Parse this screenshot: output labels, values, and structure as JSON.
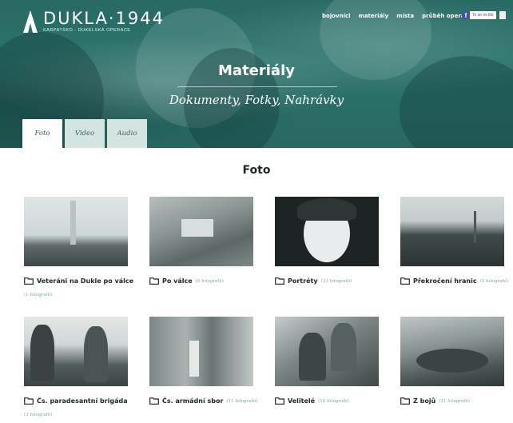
{
  "logo": {
    "title": "DUKLA·1944",
    "subtitle": "KARPATSKO - DUKELSKÁ OPERACE"
  },
  "nav": [
    "bojovníci",
    "materiály",
    "místa",
    "průběh operace"
  ],
  "facebook": {
    "label": "To se mi líbí"
  },
  "hero": {
    "title": "Materiály",
    "subtitle": "Dokumenty, Fotky, Nahrávky"
  },
  "tabs": [
    {
      "label": "Foto",
      "active": true
    },
    {
      "label": "Video",
      "active": false
    },
    {
      "label": "Audio",
      "active": false
    }
  ],
  "section_title": "Foto",
  "galleries": [
    {
      "title": "Veteráni na Dukle po válce",
      "count": "(1 fotografií)"
    },
    {
      "title": "Po válce",
      "count": "(6 fotografií)"
    },
    {
      "title": "Portréty",
      "count": "(33 fotografií)"
    },
    {
      "title": "Překročení hranic",
      "count": "(5 fotografií)"
    },
    {
      "title": "Čs. paradesantní brigáda",
      "count": "(3 fotografií)"
    },
    {
      "title": "Čs. armádní sbor",
      "count": "(11 fotografií)"
    },
    {
      "title": "Velitelé",
      "count": "(10 fotografií)"
    },
    {
      "title": "Z bojů",
      "count": "(21 fotografií)"
    }
  ],
  "colors": {
    "accent": "#2f7a73",
    "tab_inactive": "#d4e4e1",
    "count_text": "#7fa8a4"
  },
  "icons": [
    "folder-icon",
    "facebook-icon",
    "logo-a-icon"
  ]
}
